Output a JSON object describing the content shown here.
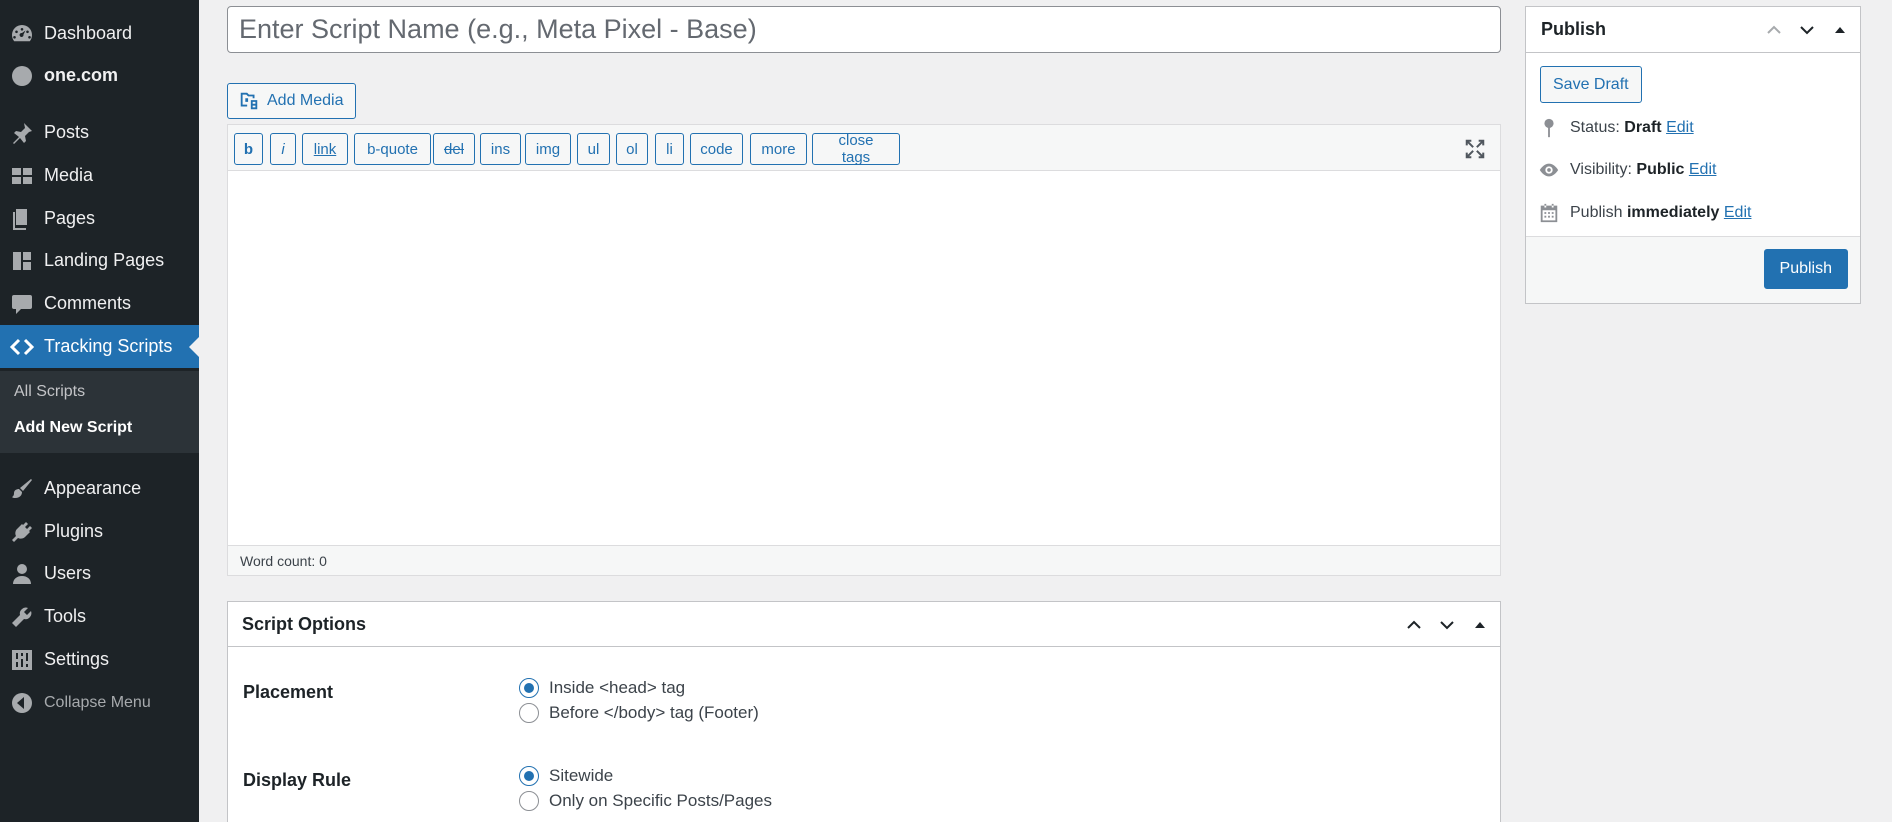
{
  "sidebar": {
    "items": [
      {
        "label": "Dashboard",
        "icon": "dashboard-icon"
      },
      {
        "label": "one.com",
        "icon": "one-com-icon"
      },
      {
        "label": "Posts",
        "icon": "pin-icon"
      },
      {
        "label": "Media",
        "icon": "media-icon"
      },
      {
        "label": "Pages",
        "icon": "pages-icon"
      },
      {
        "label": "Landing Pages",
        "icon": "layout-icon"
      },
      {
        "label": "Comments",
        "icon": "comment-icon"
      },
      {
        "label": "Tracking Scripts",
        "icon": "code-icon"
      },
      {
        "label": "Appearance",
        "icon": "brush-icon"
      },
      {
        "label": "Plugins",
        "icon": "plug-icon"
      },
      {
        "label": "Users",
        "icon": "user-icon"
      },
      {
        "label": "Tools",
        "icon": "wrench-icon"
      },
      {
        "label": "Settings",
        "icon": "sliders-icon"
      },
      {
        "label": "Collapse Menu",
        "icon": "collapse-icon"
      }
    ],
    "submenu": [
      {
        "label": "All Scripts"
      },
      {
        "label": "Add New Script"
      }
    ]
  },
  "title_input": {
    "placeholder": "Enter Script Name (e.g., Meta Pixel - Base)",
    "value": ""
  },
  "add_media": {
    "label": "Add Media"
  },
  "quicktags": [
    "b",
    "i",
    "link",
    "b-quote",
    "del",
    "ins",
    "img",
    "ul",
    "ol",
    "li",
    "code",
    "more",
    "close tags"
  ],
  "editor": {
    "word_count": "Word count: 0"
  },
  "script_options": {
    "title": "Script Options",
    "placement": {
      "label": "Placement",
      "options": [
        "Inside <head> tag",
        "Before </body> tag (Footer)"
      ],
      "selected": "Inside <head> tag"
    },
    "display_rule": {
      "label": "Display Rule",
      "options": [
        "Sitewide",
        "Only on Specific Posts/Pages"
      ],
      "selected": "Sitewide"
    }
  },
  "publish": {
    "title": "Publish",
    "save_draft": "Save Draft",
    "status_label": "Status:",
    "status_value": "Draft",
    "visibility_label": "Visibility:",
    "visibility_value": "Public",
    "schedule_label": "Publish",
    "schedule_value": "immediately",
    "edit": "Edit",
    "publish_button": "Publish"
  },
  "colors": {
    "sidebar_bg": "#1d2327",
    "accent": "#2271b1",
    "page_bg": "#f0f0f1"
  }
}
